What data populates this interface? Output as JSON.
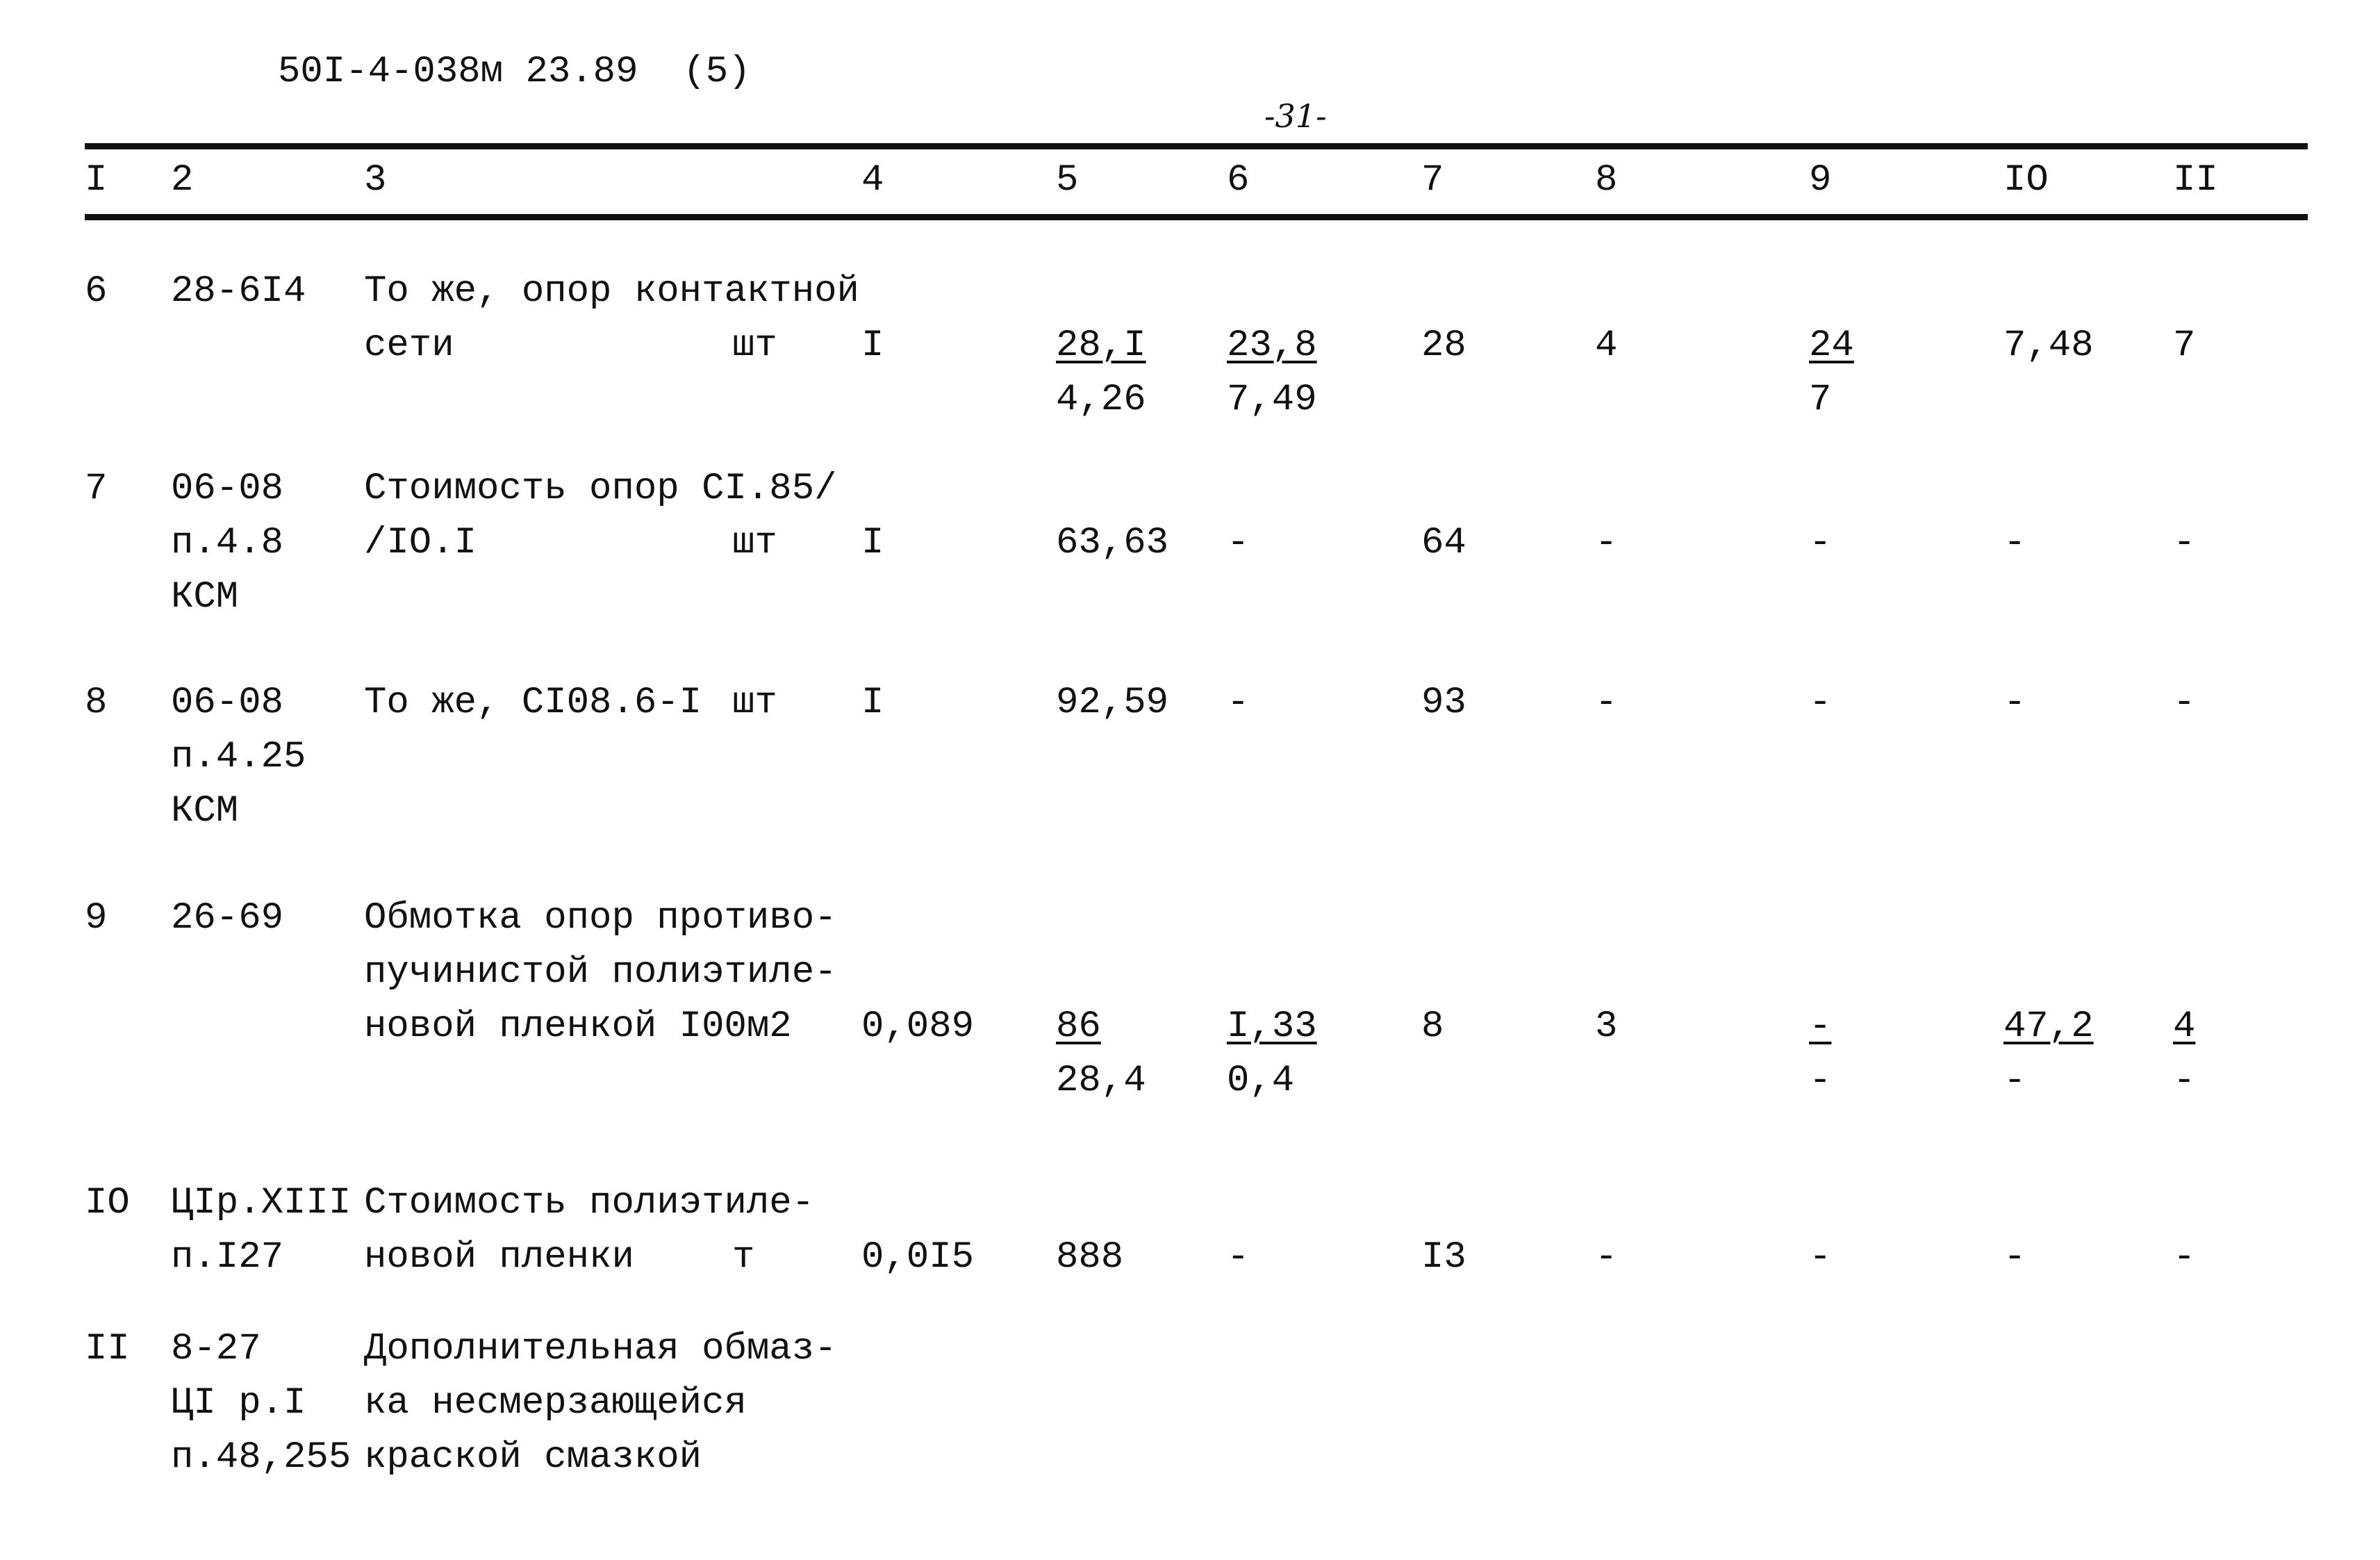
{
  "doc_code": "50I-4-038м 23.89  (5)",
  "page_number": "-31-",
  "columns": [
    "I",
    "2",
    "3",
    "4",
    "5",
    "6",
    "7",
    "8",
    "9",
    "IO",
    "II"
  ],
  "rows": [
    {
      "n": "6",
      "code": [
        "28-6I4"
      ],
      "desc": [
        "То же, опор контактной",
        "сети"
      ],
      "unit": "шт",
      "qty": "I",
      "c5": {
        "top": "28,I",
        "bottom": "4,26"
      },
      "c6": {
        "top": "23,8",
        "bottom": "7,49"
      },
      "c7": "28",
      "c8": "4",
      "c9": {
        "top": "24",
        "bottom": "7"
      },
      "c10": "7,48",
      "c11": "7"
    },
    {
      "n": "7",
      "code": [
        "06-08",
        "п.4.8",
        "КСМ"
      ],
      "desc": [
        "Стоимость опор СI.85/",
        "/IO.I"
      ],
      "unit": "шт",
      "qty": "I",
      "c5": "63,63",
      "c6": "-",
      "c7": "64",
      "c8": "-",
      "c9": "-",
      "c10": "-",
      "c11": "-"
    },
    {
      "n": "8",
      "code": [
        "06-08",
        "п.4.25",
        "КСМ"
      ],
      "desc": [
        "То же, СI08.6-I"
      ],
      "unit": "шт",
      "qty": "I",
      "c5": "92,59",
      "c6": "-",
      "c7": "93",
      "c8": "-",
      "c9": "-",
      "c10": "-",
      "c11": "-"
    },
    {
      "n": "9",
      "code": [
        "26-69"
      ],
      "desc": [
        "Обмотка опор противо-",
        "пучинистой полиэтиле-",
        "новой пленкой I00м2"
      ],
      "unit": "",
      "qty": "0,089",
      "c5": {
        "top": "86",
        "bottom": "28,4"
      },
      "c6": {
        "top": "I,33",
        "bottom": "0,4"
      },
      "c7": "8",
      "c8": "3",
      "c9": {
        "top": "-",
        "bottom": "-"
      },
      "c10": {
        "top": "47,2",
        "bottom": "-"
      },
      "c11": {
        "top": "4",
        "bottom": "-"
      }
    },
    {
      "n": "IO",
      "code": [
        "ЦIр.XIII",
        "п.I27"
      ],
      "desc": [
        "Стоимость полиэтиле-",
        "новой пленки"
      ],
      "unit": "т",
      "qty": "0,0I5",
      "c5": "888",
      "c6": "-",
      "c7": "I3",
      "c8": "-",
      "c9": "-",
      "c10": "-",
      "c11": "-"
    },
    {
      "n": "II",
      "code": [
        "8-27",
        "ЦI р.I",
        "п.48,255"
      ],
      "desc": [
        "Дополнительная обмаз-",
        "ка несмерзающейся",
        "краской смазкой"
      ],
      "unit": "",
      "qty": ""
    }
  ]
}
